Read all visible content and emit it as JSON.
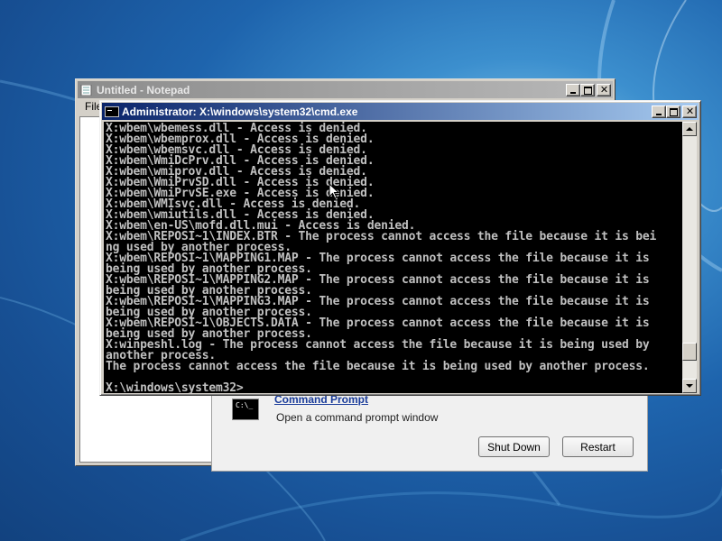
{
  "notepad": {
    "title": "Untitled - Notepad",
    "menu_file": "File"
  },
  "recovery": {
    "command_prompt_link": "Command Prompt",
    "command_prompt_desc": "Open a command prompt window",
    "shutdown_label": "Shut Down",
    "restart_label": "Restart"
  },
  "cmd": {
    "title": "Administrator: X:\\windows\\system32\\cmd.exe",
    "scroll_position": 0.92,
    "lines": [
      "X:wbem\\wbemess.dll - Access is denied.",
      "X:wbem\\wbemprox.dll - Access is denied.",
      "X:wbem\\wbemsvc.dll - Access is denied.",
      "X:wbem\\WmiDcPrv.dll - Access is denied.",
      "X:wbem\\wmiprov.dll - Access is denied.",
      "X:wbem\\WmiPrvSD.dll - Access is denied.",
      "X:wbem\\WmiPrvSE.exe - Access is denied.",
      "X:wbem\\WMIsvc.dll - Access is denied.",
      "X:wbem\\wmiutils.dll - Access is denied.",
      "X:wbem\\en-US\\mofd.dll.mui - Access is denied.",
      "X:wbem\\REPOSI~1\\INDEX.BTR - The process cannot access the file because it is bei",
      "ng used by another process.",
      "X:wbem\\REPOSI~1\\MAPPING1.MAP - The process cannot access the file because it is",
      "being used by another process.",
      "X:wbem\\REPOSI~1\\MAPPING2.MAP - The process cannot access the file because it is",
      "being used by another process.",
      "X:wbem\\REPOSI~1\\MAPPING3.MAP - The process cannot access the file because it is",
      "being used by another process.",
      "X:wbem\\REPOSI~1\\OBJECTS.DATA - The process cannot access the file because it is",
      "being used by another process.",
      "X:winpeshl.log - The process cannot access the file because it is being used by",
      "another process.",
      "The process cannot access the file because it is being used by another process.",
      "",
      "X:\\windows\\system32>"
    ]
  }
}
